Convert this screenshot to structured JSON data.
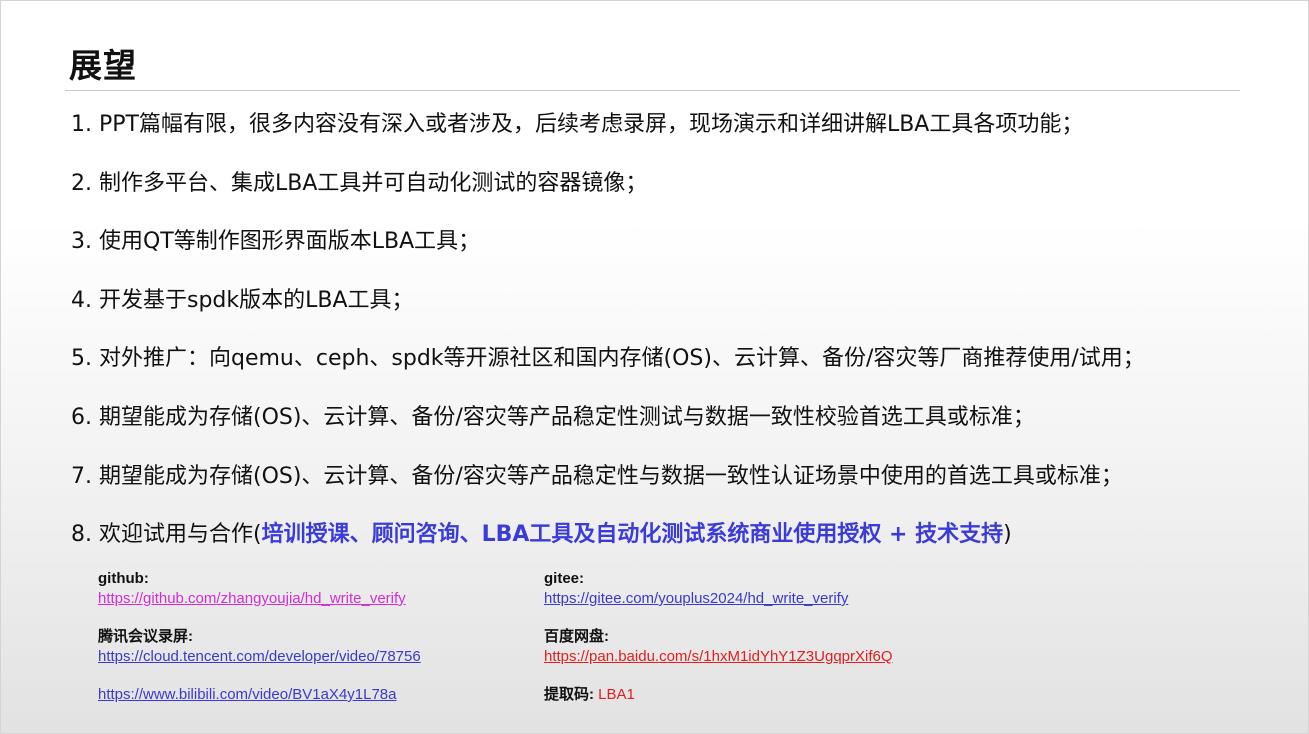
{
  "title": "展望",
  "items": [
    {
      "text": "1. PPT篇幅有限，很多内容没有深入或者涉及，后续考虑录屏，现场演示和详细讲解LBA工具各项功能；"
    },
    {
      "text": "2. 制作多平台、集成LBA工具并可自动化测试的容器镜像；"
    },
    {
      "text": "3. 使用QT等制作图形界面版本LBA工具；"
    },
    {
      "text": "4. 开发基于spdk版本的LBA工具；"
    },
    {
      "text": "5. 对外推广：向qemu、ceph、spdk等开源社区和国内存储(OS)、云计算、备份/容灾等厂商推荐使用/试用；"
    },
    {
      "text": "6. 期望能成为存储(OS)、云计算、备份/容灾等产品稳定性测试与数据一致性校验首选工具或标准；"
    },
    {
      "text": "7. 期望能成为存储(OS)、云计算、备份/容灾等产品稳定性与数据一致性认证场景中使用的首选工具或标准；"
    }
  ],
  "item8": {
    "prefix": "8. 欢迎试用与合作(",
    "highlight": "培训授课、顾问咨询、LBA工具及自动化测试系统商业使用授权 + 技术支持",
    "suffix": ")"
  },
  "links": {
    "github": {
      "label": "github:",
      "url": "https://github.com/zhangyoujia/hd_write_verify"
    },
    "gitee": {
      "label": "gitee:",
      "url": "https://gitee.com/youplus2024/hd_write_verify"
    },
    "tencent": {
      "label": "腾讯会议录屏:",
      "url": "https://cloud.tencent.com/developer/video/78756"
    },
    "baidu": {
      "label": "百度网盘:",
      "url": "https://pan.baidu.com/s/1hxM1idYhY1Z3UgqprXif6Q"
    },
    "bilibili": {
      "url": "https://www.bilibili.com/video/BV1aX4y1L78a"
    },
    "code": {
      "label": "提取码:",
      "value": "LBA1"
    }
  },
  "colors": {
    "highlight": "#3b3bd9",
    "link_blue": "#3a3ac8",
    "link_magenta": "#d12fd1",
    "link_red": "#e02020"
  }
}
